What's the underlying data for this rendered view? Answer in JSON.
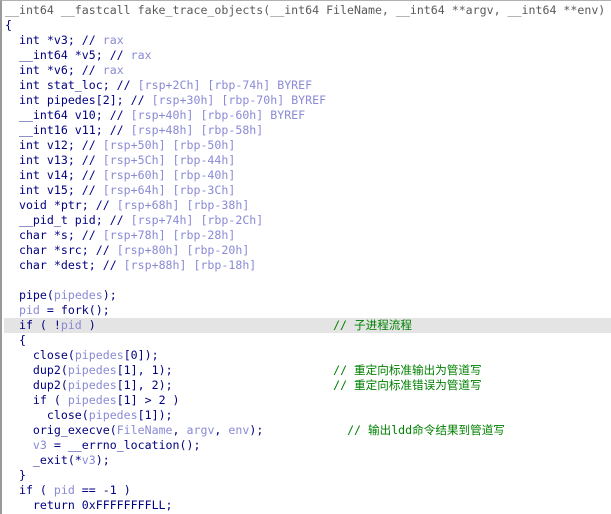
{
  "colors": {
    "keyword": "#000080",
    "variable": "#8a8ad6",
    "comment": "#008000",
    "header": "#5a5a5a",
    "highlight": "#e4e4e4"
  },
  "highlighted_line": 21,
  "lines": [
    [
      [
        "__int64 __fastcall fake_trace_objects(__int64 FileName, __int64 **argv, __int64 **env)",
        "h"
      ]
    ],
    [
      [
        "{",
        "k"
      ]
    ],
    [
      [
        "  int *v3; // ",
        "k"
      ],
      [
        "rax",
        "v"
      ]
    ],
    [
      [
        "  __int64 *v5; // ",
        "k"
      ],
      [
        "rax",
        "v"
      ]
    ],
    [
      [
        "  int *v6; // ",
        "k"
      ],
      [
        "rax",
        "v"
      ]
    ],
    [
      [
        "  int stat_loc; // ",
        "k"
      ],
      [
        "[rsp+2Ch] [rbp-74h] BYREF",
        "v"
      ]
    ],
    [
      [
        "  int pipedes[2]; // ",
        "k"
      ],
      [
        "[rsp+30h] [rbp-70h] BYREF",
        "v"
      ]
    ],
    [
      [
        "  __int64 v10; // ",
        "k"
      ],
      [
        "[rsp+40h] [rbp-60h] BYREF",
        "v"
      ]
    ],
    [
      [
        "  __int16 v11; // ",
        "k"
      ],
      [
        "[rsp+48h] [rbp-58h]",
        "v"
      ]
    ],
    [
      [
        "  int v12; // ",
        "k"
      ],
      [
        "[rsp+50h] [rbp-50h]",
        "v"
      ]
    ],
    [
      [
        "  int v13; // ",
        "k"
      ],
      [
        "[rsp+5Ch] [rbp-44h]",
        "v"
      ]
    ],
    [
      [
        "  int v14; // ",
        "k"
      ],
      [
        "[rsp+60h] [rbp-40h]",
        "v"
      ]
    ],
    [
      [
        "  int v15; // ",
        "k"
      ],
      [
        "[rsp+64h] [rbp-3Ch]",
        "v"
      ]
    ],
    [
      [
        "  void *ptr; // ",
        "k"
      ],
      [
        "[rsp+68h] [rbp-38h]",
        "v"
      ]
    ],
    [
      [
        "  __pid_t pid; // ",
        "k"
      ],
      [
        "[rsp+74h] [rbp-2Ch]",
        "v"
      ]
    ],
    [
      [
        "  char *s; // ",
        "k"
      ],
      [
        "[rsp+78h] [rbp-28h]",
        "v"
      ]
    ],
    [
      [
        "  char *src; // ",
        "k"
      ],
      [
        "[rsp+80h] [rbp-20h]",
        "v"
      ]
    ],
    [
      [
        "  char *dest; // ",
        "k"
      ],
      [
        "[rsp+88h] [rbp-18h]",
        "v"
      ]
    ],
    [],
    [
      [
        "  pipe(",
        "k"
      ],
      [
        "pipedes",
        "v"
      ],
      [
        ");",
        "k"
      ]
    ],
    [
      [
        "  ",
        "k"
      ],
      [
        "pid",
        "v"
      ],
      [
        " = fork();",
        "k"
      ]
    ],
    [
      [
        "  if ( !",
        "k"
      ],
      [
        "pid",
        "v"
      ],
      [
        " )                                  ",
        "k"
      ],
      [
        "// 子进程流程",
        "c"
      ]
    ],
    [
      [
        "  {",
        "k"
      ]
    ],
    [
      [
        "    close(",
        "k"
      ],
      [
        "pipedes",
        "v"
      ],
      [
        "[0]);",
        "k"
      ]
    ],
    [
      [
        "    dup2(",
        "k"
      ],
      [
        "pipedes",
        "v"
      ],
      [
        "[1], 1);                       ",
        "k"
      ],
      [
        "// 重定向标准输出为管道写",
        "c"
      ]
    ],
    [
      [
        "    dup2(",
        "k"
      ],
      [
        "pipedes",
        "v"
      ],
      [
        "[1], 2);                       ",
        "k"
      ],
      [
        "// 重定向标准错误为管道写",
        "c"
      ]
    ],
    [
      [
        "    if ( ",
        "k"
      ],
      [
        "pipedes",
        "v"
      ],
      [
        "[1] > 2 )",
        "k"
      ]
    ],
    [
      [
        "      close(",
        "k"
      ],
      [
        "pipedes",
        "v"
      ],
      [
        "[1]);",
        "k"
      ]
    ],
    [
      [
        "    orig_execve(",
        "k"
      ],
      [
        "FileName",
        "v"
      ],
      [
        ", ",
        "k"
      ],
      [
        "argv",
        "v"
      ],
      [
        ", ",
        "k"
      ],
      [
        "env",
        "v"
      ],
      [
        ");            ",
        "k"
      ],
      [
        "// 输出ldd命令结果到管道写",
        "c"
      ]
    ],
    [
      [
        "    ",
        "k"
      ],
      [
        "v3",
        "v"
      ],
      [
        " = __errno_location();",
        "k"
      ]
    ],
    [
      [
        "    _exit(*",
        "k"
      ],
      [
        "v3",
        "v"
      ],
      [
        ");",
        "k"
      ]
    ],
    [
      [
        "  }",
        "k"
      ]
    ],
    [
      [
        "  if ( ",
        "k"
      ],
      [
        "pid",
        "v"
      ],
      [
        " == -1 )",
        "k"
      ]
    ],
    [
      [
        "    return 0xFFFFFFFFLL;",
        "k"
      ]
    ]
  ]
}
